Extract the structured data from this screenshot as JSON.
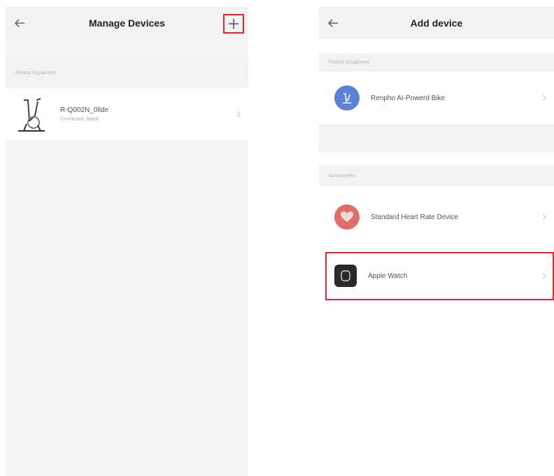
{
  "left_screen": {
    "title": "Manage Devices",
    "section_label": "Fitness Equipment",
    "device": {
      "name": "R-Q002N_0ilde",
      "status": "Connected, failed"
    }
  },
  "right_screen": {
    "title": "Add device",
    "sections": [
      {
        "label": "Fitness Equipment",
        "items": [
          {
            "label": "Renpho AI-Powerd Bike",
            "icon": "bike-icon"
          }
        ]
      },
      {
        "label": "Accessories",
        "items": [
          {
            "label": "Standard Heart Rate Device",
            "icon": "heart-icon"
          },
          {
            "label": "Apple Watch",
            "icon": "watch-icon"
          }
        ]
      }
    ]
  },
  "colors": {
    "highlight": "#e2262d",
    "bike_icon_bg": "#5b82d6",
    "heart_icon_bg": "#e06f6c",
    "watch_icon_bg": "#2a2a2a"
  }
}
